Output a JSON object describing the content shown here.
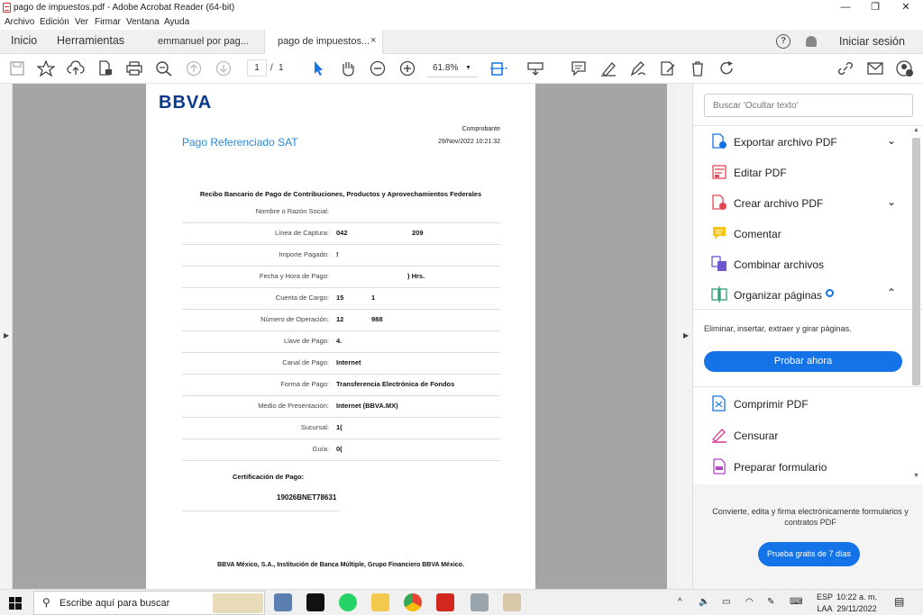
{
  "window": {
    "title": "pago de impuestos.pdf - Adobe Acrobat Reader (64-bit)"
  },
  "menu": [
    "Archivo",
    "Edición",
    "Ver",
    "Firmar",
    "Ventana",
    "Ayuda"
  ],
  "tabs": {
    "home": "Inicio",
    "tools": "Herramientas",
    "doc1": "emmanuel por pag...",
    "doc2": "pago de impuestos...",
    "close": "×",
    "signin": "Iniciar sesión"
  },
  "toolbar": {
    "page_current": "1",
    "page_sep": "/",
    "page_total": "1",
    "zoom": "61.8%"
  },
  "document": {
    "logo": "BBVA",
    "service": "Pago Referenciado SAT",
    "receipt_label": "Comprobante",
    "datetime": "29/Nov/2022 10:21:32",
    "title": "Recibo Bancario de Pago de Contribuciones, Productos y Aprovechamientos Federales",
    "rows": [
      {
        "label": "Nombre o Razón Social:",
        "value": "",
        "value2": ""
      },
      {
        "label": "Línea de Captura:",
        "value": "042",
        "value2": "209"
      },
      {
        "label": "Importe Pagado:",
        "value": "!",
        "value2": ""
      },
      {
        "label": "Fecha y Hora de Pago:",
        "value": "",
        "value2": ") Hrs."
      },
      {
        "label": "Cuenta de Cargo:",
        "value": "15",
        "value2": "1"
      },
      {
        "label": "Número de Operación:",
        "value": "12",
        "value2": "988"
      },
      {
        "label": "Llave de Pago:",
        "value": "4.",
        "value2": ""
      },
      {
        "label": "Canal de Pago:",
        "value": "Internet",
        "value2": ""
      },
      {
        "label": "Forma de Pago:",
        "value": "Transferencia Electrónica de Fondos",
        "value2": ""
      },
      {
        "label": "Medio de Presentación:",
        "value": "Internet (BBVA.MX)",
        "value2": ""
      },
      {
        "label": "Sucursal:",
        "value": "1(",
        "value2": ""
      },
      {
        "label": "Guía:",
        "value": "0(",
        "value2": ""
      }
    ],
    "cert_label": "Certificación de Pago:",
    "cert_value": "19026BNET78631",
    "footer": "BBVA México, S.A., Institución de Banca Múltiple, Grupo Financiero BBVA México."
  },
  "right_panel": {
    "search_placeholder": "Buscar 'Ocultar texto'",
    "tools": [
      {
        "label": "Exportar archivo PDF",
        "icon": "export-pdf-icon",
        "color": "#1473e6"
      },
      {
        "label": "Editar PDF",
        "icon": "edit-pdf-icon",
        "color": "#e34850"
      },
      {
        "label": "Crear archivo PDF",
        "icon": "create-pdf-icon",
        "color": "#e34850"
      },
      {
        "label": "Comentar",
        "icon": "comment-icon",
        "color": "#f5c518"
      },
      {
        "label": "Combinar archivos",
        "icon": "combine-icon",
        "color": "#6e56cf"
      },
      {
        "label": "Organizar páginas",
        "icon": "organize-pages-icon",
        "color": "#2d9d78"
      },
      {
        "label": "Comprimir PDF",
        "icon": "compress-icon",
        "color": "#1473e6"
      },
      {
        "label": "Censurar",
        "icon": "redact-icon",
        "color": "#d83790"
      },
      {
        "label": "Preparar formulario",
        "icon": "form-icon",
        "color": "#b548c6"
      }
    ],
    "organize_desc": "Eliminar, insertar, extraer y girar páginas.",
    "try_now": "Probar ahora",
    "promo_text": "Convierte, edita y firma electrónicamente formularios y contratos PDF",
    "promo_button": "Prueba gratis de 7 días"
  },
  "taskbar": {
    "search": "Escribe aquí para buscar",
    "lang1": "ESP",
    "lang2": "LAA",
    "time": "10:22 a. m.",
    "date": "29/11/2022"
  }
}
